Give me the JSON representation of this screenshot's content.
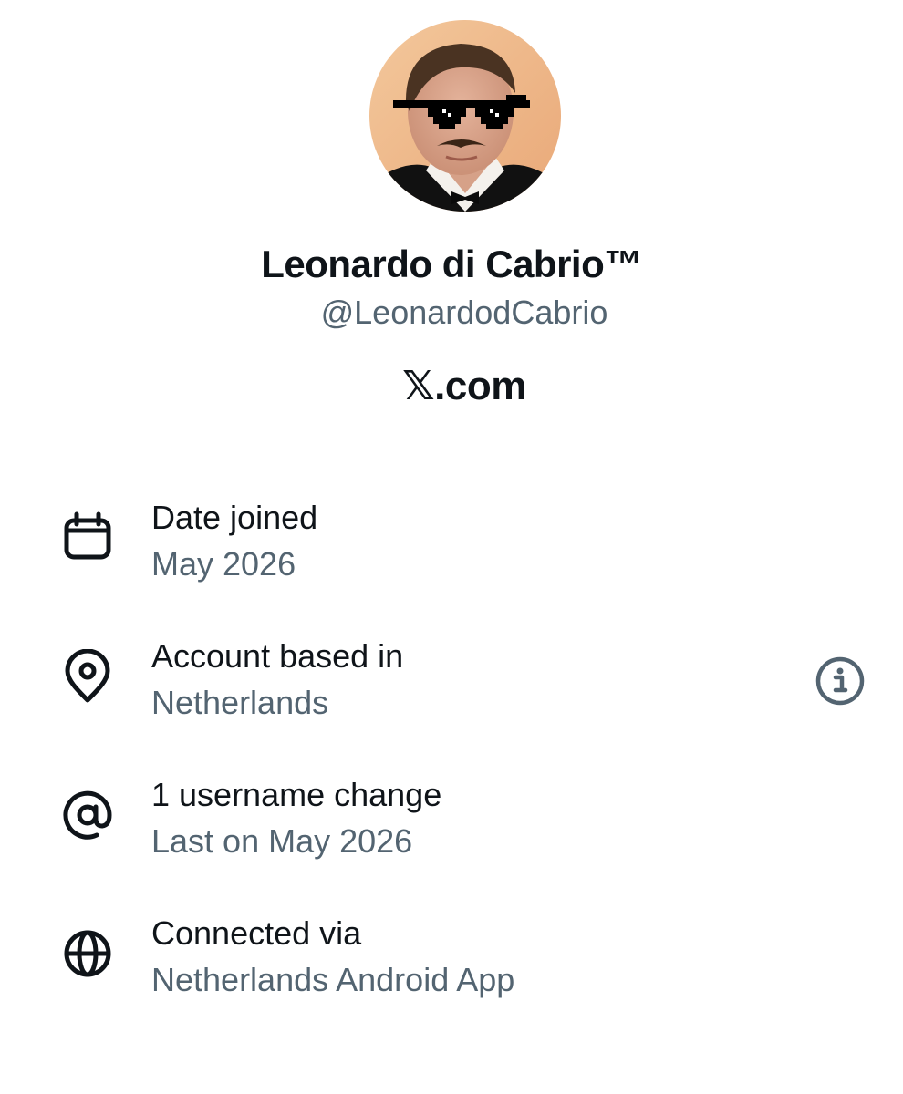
{
  "profile": {
    "display_name": "Leonardo di Cabrio™",
    "handle": "@LeonardodCabrio",
    "site": "𝕏.com"
  },
  "about": {
    "items": [
      {
        "icon": "calendar-icon",
        "label": "Date joined",
        "value": "May 2026"
      },
      {
        "icon": "location-pin-icon",
        "label": "Account based in",
        "value": "Netherlands"
      },
      {
        "icon": "at-sign-icon",
        "label": "1 username change",
        "value": "Last on May 2026"
      },
      {
        "icon": "globe-icon",
        "label": "Connected via",
        "value": "Netherlands Android App"
      }
    ]
  },
  "colors": {
    "primary_text": "#0f1419",
    "secondary_text": "#536471",
    "background": "#ffffff"
  }
}
